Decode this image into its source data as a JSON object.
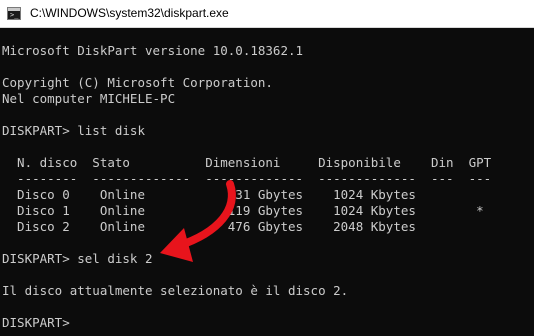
{
  "window": {
    "title": "C:\\WINDOWS\\system32\\diskpart.exe"
  },
  "console": {
    "lines": [
      "Microsoft DiskPart versione 10.0.18362.1",
      "Copyright (C) Microsoft Corporation.",
      "Nel computer MICHELE-PC",
      "DISKPART> list disk",
      "  N. disco  Stato          Dimensioni     Disponibile    Din  GPT",
      "  --------  -------------  -------------  -------------  ---  ---",
      "  Disco 0    Online           931 Gbytes    1024 Kbytes",
      "  Disco 1    Online           119 Gbytes    1024 Kbytes        *",
      "  Disco 2    Online           476 Gbytes    2048 Kbytes",
      "DISKPART> sel disk 2",
      "Il disco attualmente selezionato è il disco 2.",
      "DISKPART>"
    ]
  },
  "annotation": {
    "arrow_color": "#e8141c"
  }
}
